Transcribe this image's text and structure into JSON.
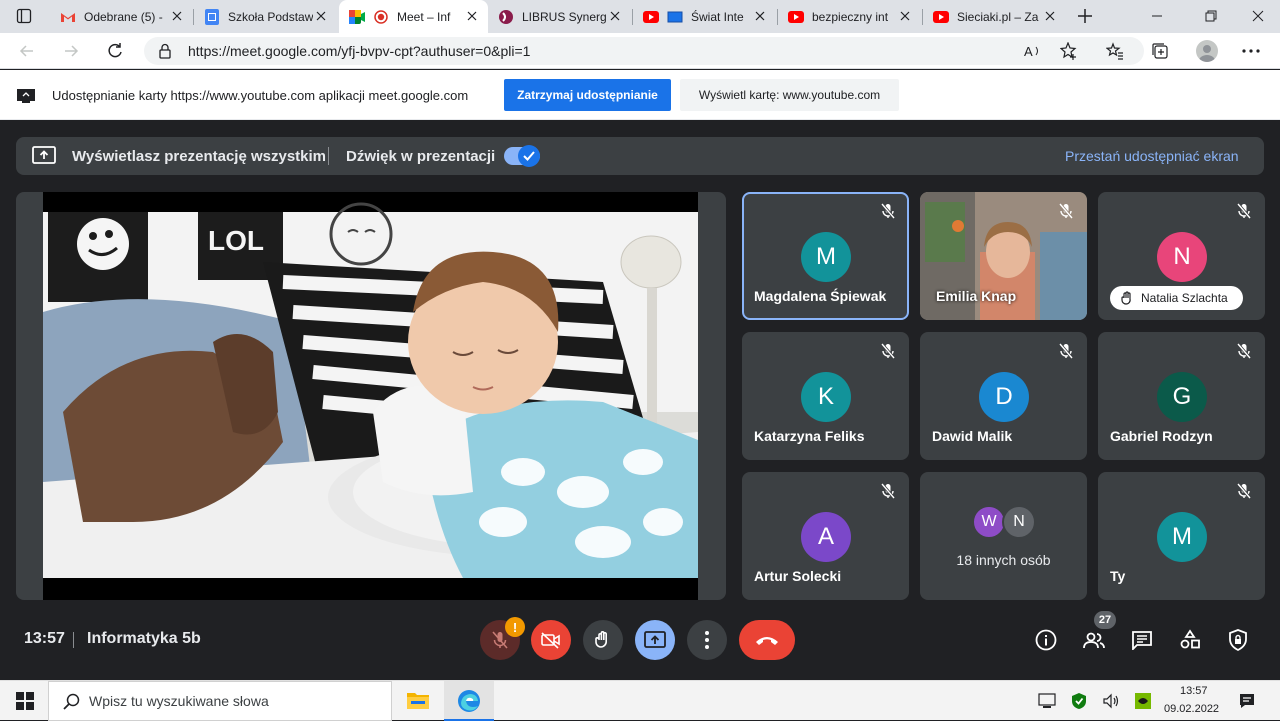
{
  "browser": {
    "tabs": [
      {
        "title": "Odebrane (5) - ",
        "icon": "gmail-icon",
        "active": false
      },
      {
        "title": "Szkoła Podstaw",
        "icon": "google-sites-icon",
        "active": false
      },
      {
        "title": "Meet – Inf",
        "icon": "google-meet-icon",
        "active": true
      },
      {
        "title": "LIBRUS Synergi",
        "icon": "librus-icon",
        "active": false
      },
      {
        "title": "Świat Inte",
        "icon": "youtube-icon",
        "active": false
      },
      {
        "title": "bezpieczny int",
        "icon": "youtube-icon",
        "active": false
      },
      {
        "title": "Sieciaki.pl – Za",
        "icon": "youtube-icon",
        "active": false
      }
    ],
    "url": "https://meet.google.com/yfj-bvpv-cpt?authuser=0&pli=1"
  },
  "sharing_bar": {
    "message": "Udostępnianie karty https://www.youtube.com aplikacji meet.google.com",
    "stop_label": "Zatrzymaj udostępnianie",
    "show_tab_label": "Wyświetl kartę: www.youtube.com"
  },
  "meet": {
    "presenting_text": "Wyświetlasz prezentację wszystkim",
    "audio_label": "Dźwięk w prezentacji",
    "audio_enabled": true,
    "stop_presenting_label": "Przestań udostępniać ekran",
    "video_sign": "LOL",
    "participants": [
      {
        "name": "Magdalena Śpiewak",
        "initial": "M",
        "color": "#12939a"
      },
      {
        "name": "Emilia Knap",
        "initial": "",
        "color": ""
      },
      {
        "name": "Natalia Szlachta",
        "initial": "N",
        "color": "#e8457a"
      },
      {
        "name": "Katarzyna Feliks",
        "initial": "K",
        "color": "#12939a"
      },
      {
        "name": "Dawid Malik",
        "initial": "D",
        "color": "#1a88d1"
      },
      {
        "name": "Gabriel Rodzyn",
        "initial": "G",
        "color": "#0b5a4a"
      },
      {
        "name": "Artur Solecki",
        "initial": "A",
        "color": "#7b48c9"
      },
      {
        "name": "18 innych osób",
        "initial": "",
        "color": ""
      },
      {
        "name": "Ty",
        "initial": "M",
        "color": "#12939a"
      }
    ],
    "others_avatars": [
      {
        "initial": "W",
        "color": "#8e4cc7"
      },
      {
        "initial": "N",
        "color": "#5f6368"
      }
    ],
    "time": "13:57",
    "meeting_name": "Informatyka 5b",
    "people_count": "27"
  },
  "taskbar": {
    "search_placeholder": "Wpisz tu wyszukiwane słowa",
    "time": "13:57",
    "date": "09.02.2022"
  }
}
